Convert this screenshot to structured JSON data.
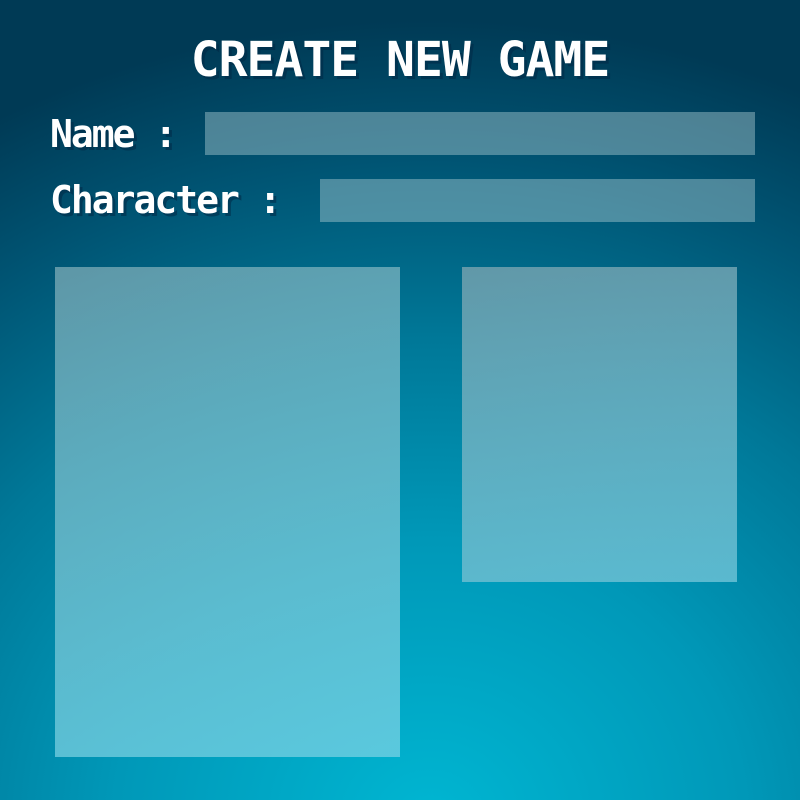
{
  "screen": {
    "title": "CREATE NEW GAME"
  },
  "form": {
    "name_label": "Name :",
    "name_value": "",
    "character_label": "Character :",
    "character_value": ""
  },
  "panels": {
    "left": "",
    "right": ""
  },
  "colors": {
    "background_dark": "#003a55",
    "background_light": "#00b6d2",
    "text": "#ffffff"
  }
}
